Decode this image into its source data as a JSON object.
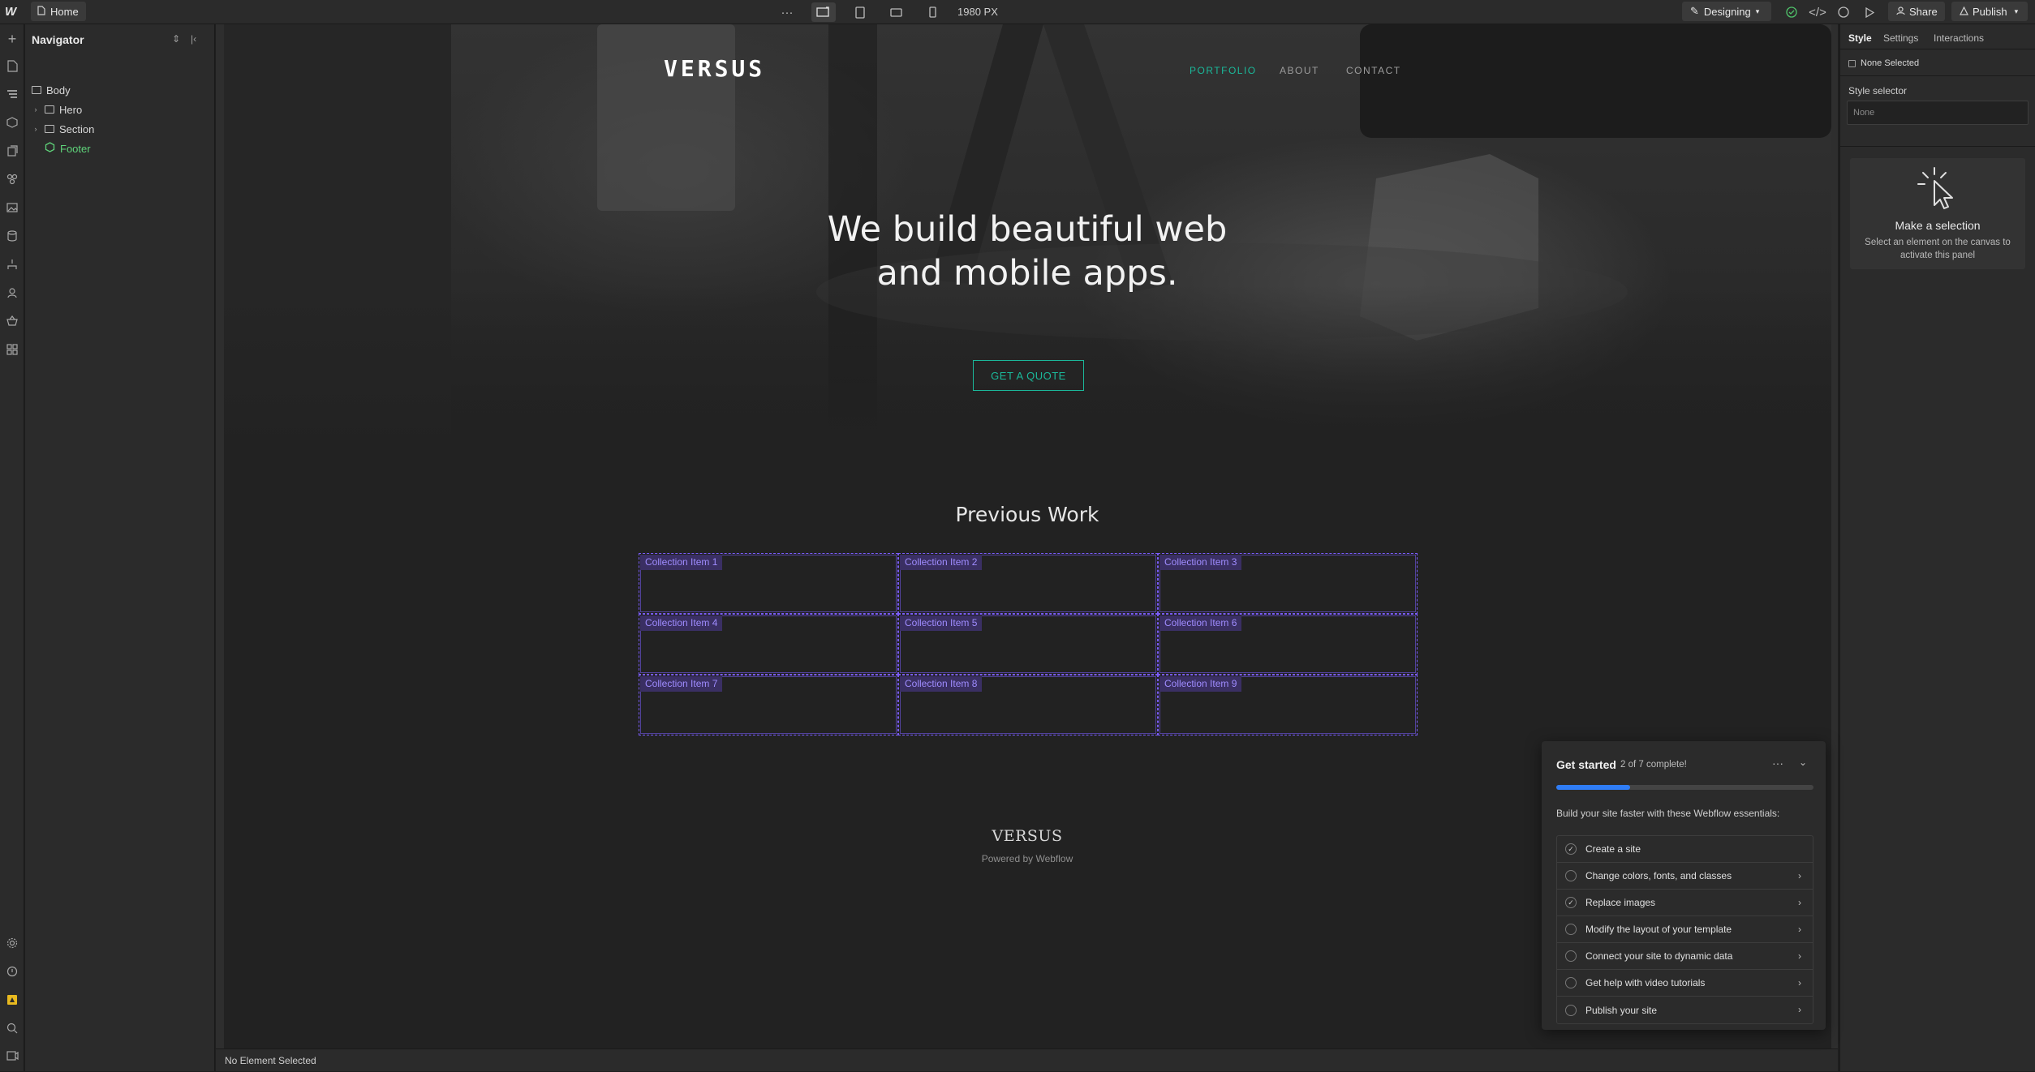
{
  "topbar": {
    "logo": "W",
    "page": "Home",
    "more": "···",
    "canvas_width": "1980 PX",
    "mode": "Designing",
    "share": "Share",
    "publish": "Publish"
  },
  "navigator": {
    "title": "Navigator",
    "items": [
      {
        "label": "Body"
      },
      {
        "label": "Hero"
      },
      {
        "label": "Section"
      },
      {
        "label": "Footer"
      }
    ]
  },
  "site": {
    "logo": "VERSUS",
    "nav": [
      "PORTFOLIO",
      "ABOUT",
      "CONTACT"
    ],
    "hero_title": "We build beautiful web and mobile apps.",
    "cta": "GET A QUOTE",
    "section_title": "Previous Work",
    "collection_items": [
      "Collection Item 1",
      "Collection Item 2",
      "Collection Item 3",
      "Collection Item 4",
      "Collection Item 5",
      "Collection Item 6",
      "Collection Item 7",
      "Collection Item 8",
      "Collection Item 9"
    ],
    "footer_brand": "VERSUS",
    "footer_powered": "Powered by Webflow"
  },
  "statusbar": {
    "text": "No Element Selected"
  },
  "rightpanel": {
    "tabs": [
      "Style",
      "Settings",
      "Interactions"
    ],
    "none_selected": "None Selected",
    "style_selector_label": "Style selector",
    "style_selector_value": "None",
    "card_title": "Make a selection",
    "card_desc": "Select an element on the canvas to activate this panel"
  },
  "get_started": {
    "title": "Get started",
    "progress_text": "2 of 7 complete!",
    "progress_fraction": 0.2857,
    "subtitle": "Build your site faster with these Webflow essentials:",
    "items": [
      {
        "label": "Create a site",
        "done": true
      },
      {
        "label": "Change colors, fonts, and classes",
        "done": false
      },
      {
        "label": "Replace images",
        "done": true
      },
      {
        "label": "Modify the layout of your template",
        "done": false
      },
      {
        "label": "Connect your site to dynamic data",
        "done": false
      },
      {
        "label": "Get help with video tutorials",
        "done": false
      },
      {
        "label": "Publish your site",
        "done": false
      }
    ]
  },
  "colors": {
    "accent": "#1bb89a",
    "collection_outline": "#7a5cff",
    "progress": "#2f7df6",
    "footer_nav_item": "#5fd37a"
  }
}
